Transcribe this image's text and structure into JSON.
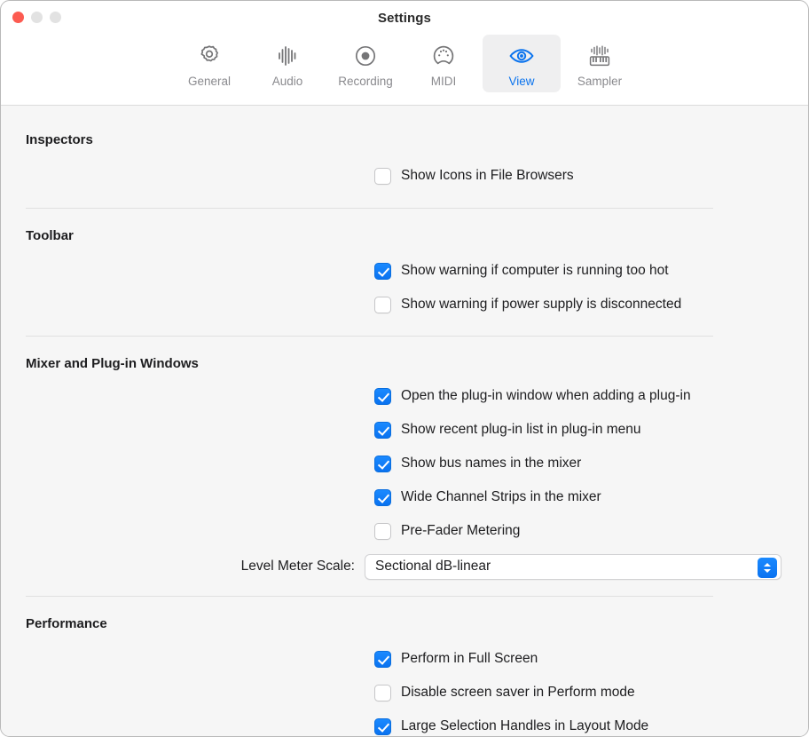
{
  "window": {
    "title": "Settings",
    "traffic_lights": [
      "close",
      "minimize",
      "maximize"
    ]
  },
  "toolbar": {
    "items": [
      {
        "id": "general",
        "label": "General",
        "icon": "gear-icon",
        "selected": false
      },
      {
        "id": "audio",
        "label": "Audio",
        "icon": "waveform-icon",
        "selected": false
      },
      {
        "id": "recording",
        "label": "Recording",
        "icon": "record-icon",
        "selected": false
      },
      {
        "id": "midi",
        "label": "MIDI",
        "icon": "midi-port-icon",
        "selected": false
      },
      {
        "id": "view",
        "label": "View",
        "icon": "eye-icon",
        "selected": true
      },
      {
        "id": "sampler",
        "label": "Sampler",
        "icon": "keyboard-icon",
        "selected": false
      }
    ]
  },
  "colors": {
    "accent": "#0a72f0",
    "selected_tab_bg": "#efeff0",
    "content_bg": "#f6f6f6",
    "title_bar_bg": "#ffffff",
    "close_button": "#fc5b51",
    "inactive_button": "#e2e2e2",
    "divider": "#e0e0e0"
  },
  "sections": [
    {
      "id": "inspectors",
      "title": "Inspectors",
      "checkboxes": [
        {
          "label": "Show Icons in File Browsers",
          "checked": false
        }
      ]
    },
    {
      "id": "toolbar",
      "title": "Toolbar",
      "checkboxes": [
        {
          "label": "Show warning if computer is running too hot",
          "checked": true
        },
        {
          "label": "Show warning if power supply is disconnected",
          "checked": false
        }
      ]
    },
    {
      "id": "mixer-and-plugin-windows",
      "title": "Mixer and Plug-in Windows",
      "checkboxes": [
        {
          "label": "Open the plug-in window when adding a plug-in",
          "checked": true
        },
        {
          "label": "Show recent plug-in list in plug-in menu",
          "checked": true
        },
        {
          "label": "Show bus names in the mixer",
          "checked": true
        },
        {
          "label": "Wide Channel Strips in the mixer",
          "checked": true
        },
        {
          "label": "Pre-Fader Metering",
          "checked": false
        }
      ],
      "popup": {
        "label": "Level Meter Scale:",
        "value": "Sectional dB-linear"
      }
    },
    {
      "id": "performance",
      "title": "Performance",
      "checkboxes": [
        {
          "label": "Perform in Full Screen",
          "checked": true
        },
        {
          "label": "Disable screen saver in Perform mode",
          "checked": false
        },
        {
          "label": "Large Selection Handles in Layout Mode",
          "checked": true
        }
      ]
    }
  ]
}
